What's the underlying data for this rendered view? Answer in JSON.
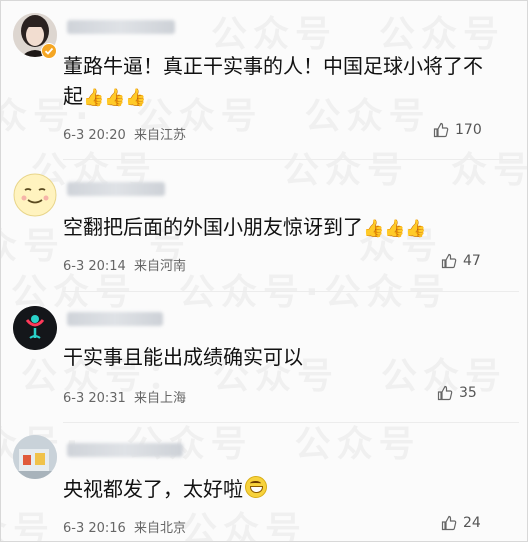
{
  "watermark": "公众号",
  "comments": [
    {
      "text_line1": "董路牛逼！真正干实事的人！中国足球小将了不",
      "text_line2": "起",
      "emoji": "👍👍👍",
      "time": "6-3 20:20",
      "location": "来自江苏",
      "likes": "170",
      "avatar_icon": "girl-avatar-verified"
    },
    {
      "text_line1": "空翻把后面的外国小朋友惊讶到了",
      "emoji": "👍👍👍",
      "time": "6-3 20:14",
      "location": "来自河南",
      "likes": "47",
      "avatar_icon": "smiley-face-avatar"
    },
    {
      "text_line1": "干实事且能出成绩确实可以",
      "time": "6-3 20:31",
      "location": "来自上海",
      "likes": "35",
      "avatar_icon": "dark-flower-avatar"
    },
    {
      "text_line1": "央视都发了，太好啦",
      "emoji": "grin",
      "time": "6-3 20:16",
      "location": "来自北京",
      "likes": "24",
      "avatar_icon": "photo-avatar"
    }
  ]
}
